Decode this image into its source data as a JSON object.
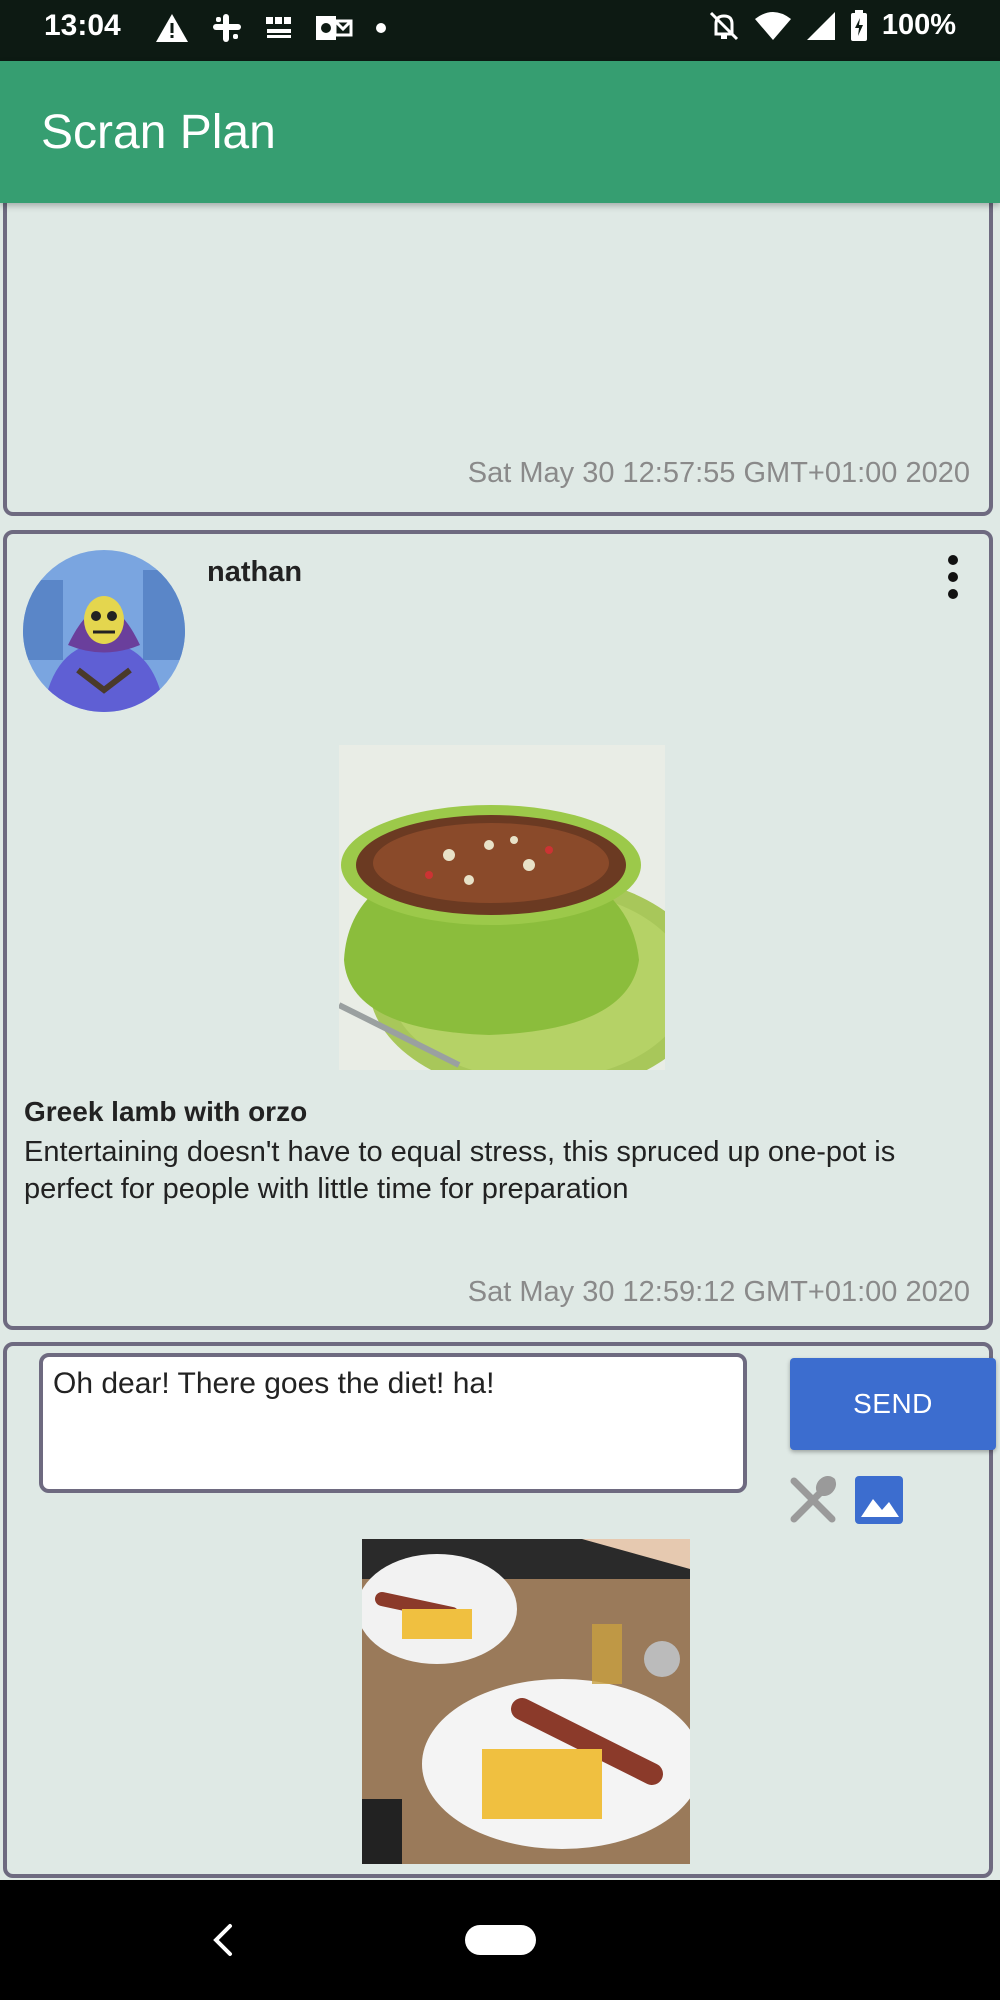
{
  "status_bar": {
    "time": "13:04",
    "battery": "100%",
    "left_icons": [
      "warning-icon",
      "slack-icon",
      "bbc-news-icon",
      "outlook-icon",
      "dot-icon"
    ],
    "right_icons": [
      "do-not-disturb-icon",
      "wifi-icon",
      "signal-icon",
      "battery-icon"
    ]
  },
  "app_bar": {
    "title": "Scran Plan"
  },
  "posts": [
    {
      "timestamp": "Sat May 30 12:57:55 GMT+01:00 2020"
    },
    {
      "username": "nathan",
      "recipe_title": "Greek lamb with orzo",
      "recipe_description": "Entertaining doesn't have to equal stress, this spruced up one-pot is perfect for people with little time for preparation",
      "timestamp": "Sat May 30 12:59:12 GMT+01:00 2020"
    }
  ],
  "compose": {
    "message": "Oh dear! There goes the diet! ha!",
    "send_label": "SEND"
  },
  "colors": {
    "app_bar": "#369e71",
    "background": "#dfe9e5",
    "send_button": "#3c6dcf",
    "card_border": "#6e6a80"
  }
}
